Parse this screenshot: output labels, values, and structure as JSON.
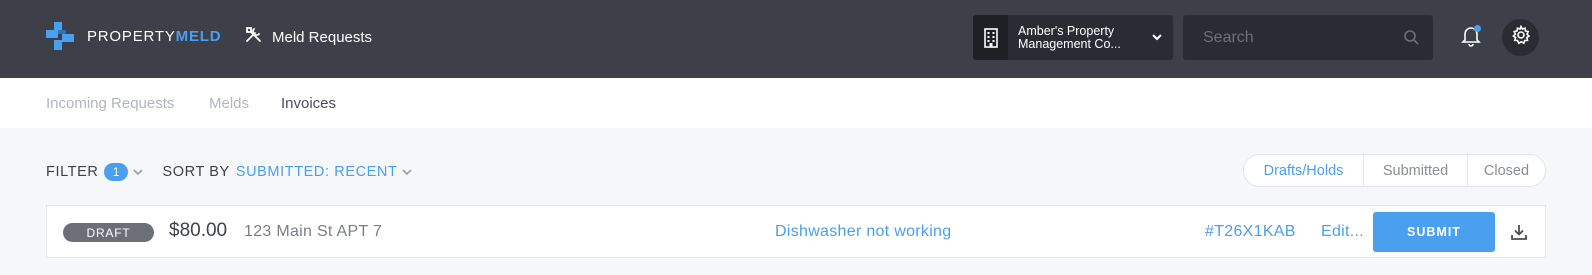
{
  "header": {
    "logo_light": "PROPERTY",
    "logo_bold": "MELD",
    "page_title": "Meld Requests",
    "org_name": "Amber's Property Management Co...",
    "search_placeholder": "Search"
  },
  "subnav": {
    "tabs": [
      {
        "label": "Incoming Requests",
        "active": false
      },
      {
        "label": "Melds",
        "active": false
      },
      {
        "label": "Invoices",
        "active": true
      }
    ]
  },
  "toolbar": {
    "filter_label": "FILTER",
    "filter_count": "1",
    "sort_label": "SORT BY",
    "sort_value": "SUBMITTED: RECENT",
    "status_tabs": [
      {
        "label": "Drafts/Holds",
        "selected": true
      },
      {
        "label": "Submitted",
        "selected": false
      },
      {
        "label": "Closed",
        "selected": false
      }
    ]
  },
  "invoices": [
    {
      "status": "DRAFT",
      "amount": "$80.00",
      "address": "123 Main St APT 7",
      "description": "Dishwasher not working",
      "reference": "#T26X1KAB",
      "edit_label": "Edit...",
      "submit_label": "SUBMIT"
    }
  ],
  "colors": {
    "topbar": "#3e4049",
    "accent": "#4a9fee",
    "draft_badge": "#6d6f77"
  },
  "icons": {
    "logo": "propertymeld-logo-icon",
    "page": "tools-icon",
    "org": "building-icon",
    "org_dropdown": "chevron-down-icon",
    "search": "search-icon",
    "notifications": "bell-icon",
    "settings": "gear-icon",
    "download": "download-icon"
  }
}
